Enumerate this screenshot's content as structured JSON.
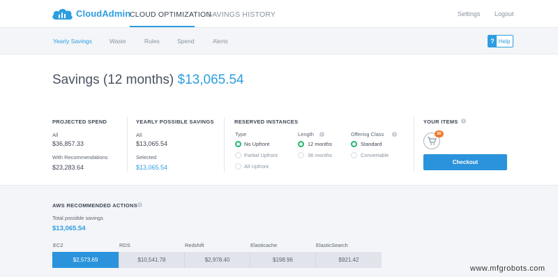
{
  "brand": {
    "name": "CloudAdmin",
    "logo_icon": "cloud-chart-icon",
    "accent": "#2d9ee0"
  },
  "topnav": {
    "tabs": [
      {
        "label": "CLOUD OPTIMIZATION",
        "active": true
      },
      {
        "label": "SAVINGS HISTORY",
        "active": false
      }
    ],
    "settings": "Settings",
    "logout": "Logout"
  },
  "subnav": {
    "tabs": [
      {
        "label": "Yearly Savings",
        "active": true
      },
      {
        "label": "Waste"
      },
      {
        "label": "Rules"
      },
      {
        "label": "Spend"
      },
      {
        "label": "Alerts"
      }
    ],
    "help": {
      "icon": "?",
      "label": "Help"
    }
  },
  "title": {
    "text": "Savings (12 months)",
    "amount": "$13,065.54"
  },
  "projected": {
    "heading": "PROJECTED SPEND",
    "all_label": "All",
    "all_value": "$36,857.33",
    "rec_label": "With Recommendations",
    "rec_value": "$23,283.64"
  },
  "yearly": {
    "heading": "YEARLY POSSIBLE SAVINGS",
    "all_label": "All",
    "all_value": "$13,065.54",
    "selected_label": "Selected",
    "selected_value": "$13,065.54"
  },
  "reserved": {
    "heading": "RESERVED INSTANCES",
    "type": {
      "label": "Type",
      "options": [
        {
          "label": "No Upfront",
          "selected": true
        },
        {
          "label": "Partial Upfront",
          "selected": false
        },
        {
          "label": "All Upfront",
          "selected": false
        }
      ]
    },
    "length": {
      "label": "Length",
      "options": [
        {
          "label": "12 months",
          "selected": true
        },
        {
          "label": "36 months",
          "selected": false
        }
      ]
    },
    "offering": {
      "label": "Offering Class",
      "options": [
        {
          "label": "Standard",
          "selected": true
        },
        {
          "label": "Convertable",
          "selected": false
        }
      ]
    }
  },
  "items": {
    "heading": "YOUR ITEMS",
    "badge": "56",
    "checkout": "Checkout"
  },
  "aws": {
    "heading": "AWS RECOMMENDED ACTIONS",
    "total_label": "Total possible savings",
    "total_value": "$13,065.54",
    "services": [
      {
        "name": "EC2",
        "value": "$2,573.69",
        "active": true
      },
      {
        "name": "RDS",
        "value": "$10,541.78"
      },
      {
        "name": "Redshift",
        "value": "$2,978.40"
      },
      {
        "name": "Elasticache",
        "value": "$198.96"
      },
      {
        "name": "ElasticSearch",
        "value": "$921.42"
      }
    ]
  },
  "colors": {
    "green": "#22b573",
    "button": "#2a93db",
    "badge": "#f27a2e"
  },
  "watermark": "www.mfgrobots.com"
}
